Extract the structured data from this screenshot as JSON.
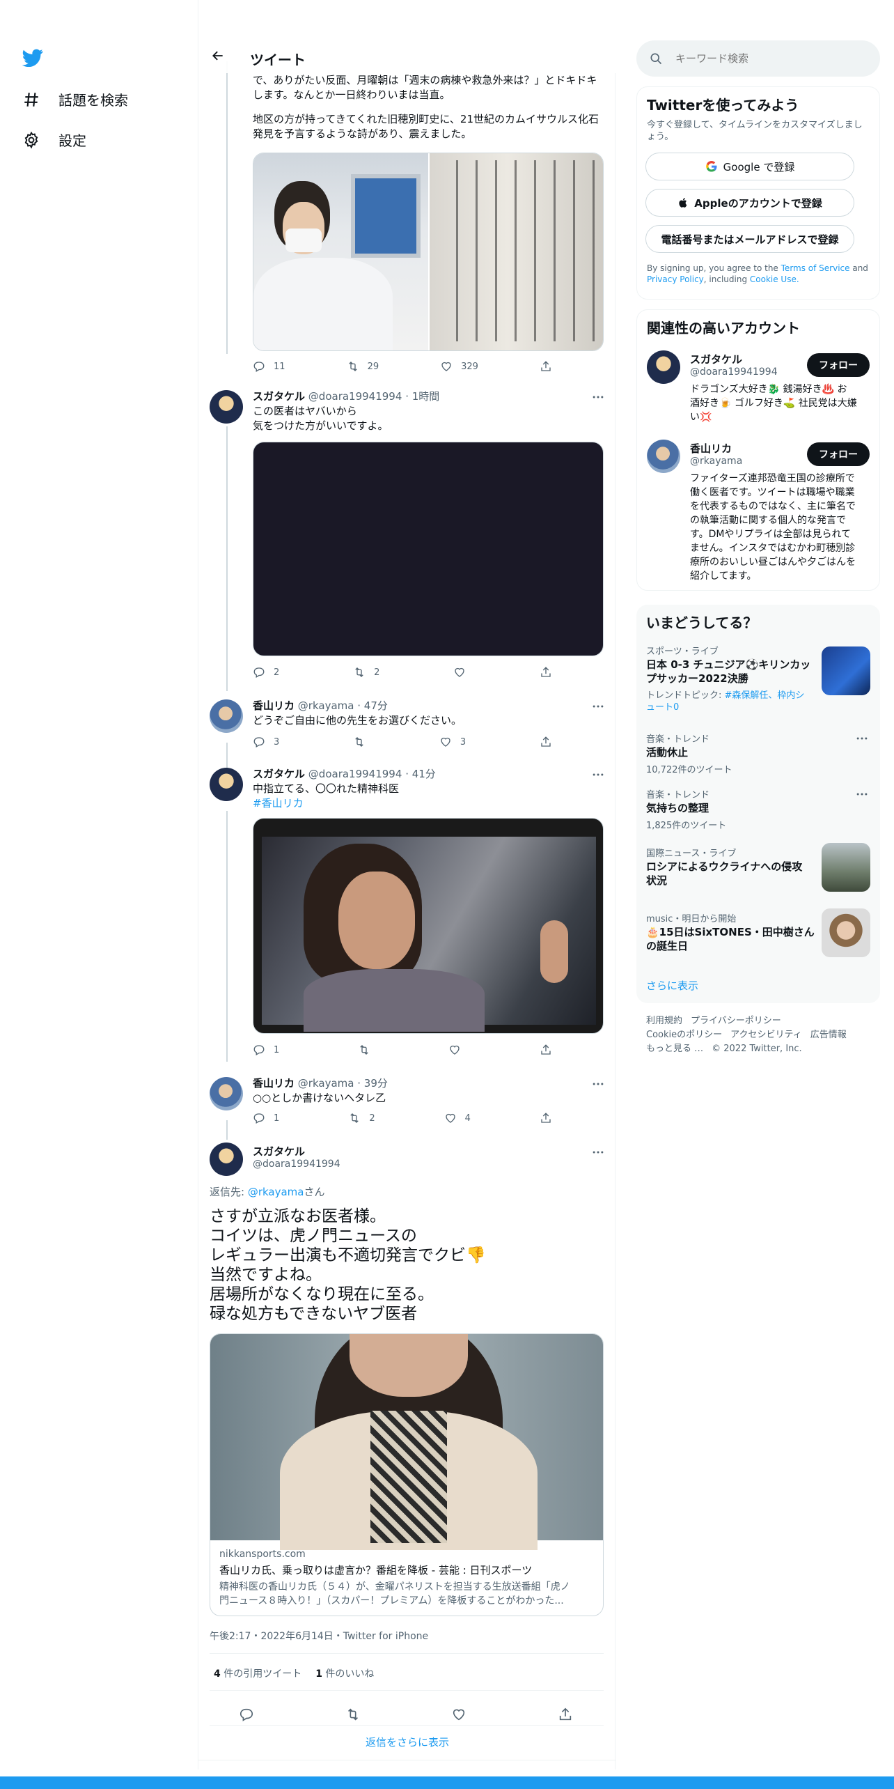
{
  "nav": {
    "explore_label": "話題を検索",
    "settings_label": "設定"
  },
  "header": {
    "title": "ツイート"
  },
  "tweet0": {
    "text1a": "で、ありがたい反面、月曜朝は「週末の病棟や救急外来は？」とドキドキ",
    "text1b": "します。なんとか一日終わりいまは当直。",
    "text2a": "地区の方が持ってきてくれた旧穂別町史に、21世紀のカムイサウルス化石",
    "text2b": "発見を予言するような詩があり、震えました。",
    "replies": "11",
    "retweets": "29",
    "likes": "329"
  },
  "tweet1": {
    "name": "スガタケル",
    "handle": "@doara19941994",
    "time": "· 1時間",
    "line1": "この医者はヤバいから",
    "line2": "気をつけた方がいいですよ。",
    "replies": "2",
    "retweets": "2"
  },
  "tweet2": {
    "name": "香山リカ",
    "handle": "@rkayama",
    "time": "· 47分",
    "text": "どうぞご自由に他の先生をお選びください。",
    "replies": "3",
    "likes": "3"
  },
  "tweet3": {
    "name": "スガタケル",
    "handle": "@doara19941994",
    "time": "· 41分",
    "line1": "中指立てる、〇〇れた精神科医",
    "hashtag": "#香山リカ",
    "replies": "1"
  },
  "tweet4": {
    "name": "香山リカ",
    "handle": "@rkayama",
    "time": "· 39分",
    "text": "○○としか書けないヘタレ乙",
    "replies": "1",
    "retweets": "2",
    "likes": "4"
  },
  "main_tweet": {
    "name": "スガタケル",
    "handle": "@doara19941994",
    "reply_to_prefix": "返信先: ",
    "reply_to_handle": "@rkayama",
    "reply_to_suffix": "さん",
    "lines": [
      "さすが立派なお医者様。",
      "コイツは、虎ノ門ニュースの",
      "レギュラー出演も不適切発言でクビ👎",
      "当然ですよね。",
      "居場所がなくなり現在に至る。",
      "碌な処方もできないヤブ医者"
    ],
    "card_domain": "nikkansports.com",
    "card_title": "香山リカ氏、乗っ取りは虚言か？番組を降板 - 芸能 : 日刊スポーツ",
    "card_desc1": "精神科医の香山リカ氏（５４）が、金曜パネリストを担当する生放送番組「虎ノ",
    "card_desc2": "門ニュース８時入り！」（スカパー！プレミアム）を降板することがわかった...",
    "timestamp": "午後2:17・2022年6月14日・Twitter for iPhone",
    "quote_count": "4",
    "quote_label": " 件の引用ツイート",
    "like_count": "1",
    "like_label": " 件のいいね",
    "show_more_replies": "返信をさらに表示"
  },
  "search": {
    "placeholder": "キーワード検索"
  },
  "signup": {
    "title": "Twitterを使ってみよう",
    "desc1": "今すぐ登録して、タイムラインをカスタマイズしまし",
    "desc2": "ょう。",
    "google": "Google で登録",
    "apple": "Appleのアカウントで登録",
    "phone": "電話番号またはメールアドレスで登録",
    "terms_prefix": "By signing up, you agree to the ",
    "terms_link": "Terms of Service",
    "terms_and": " and",
    "privacy_link": "Privacy Policy",
    "including": ", including ",
    "cookie_link": "Cookie Use."
  },
  "relevant": {
    "title": "関連性の高いアカウント",
    "follow_label": "フォロー",
    "accounts": [
      {
        "name": "スガタケル",
        "handle": "@doara19941994",
        "bio": [
          "ドラゴンズ大好き🐉 銭湯好き♨️ お",
          "酒好き🍺 ゴルフ好き⛳ 社民党は大嫌",
          "い💢"
        ]
      },
      {
        "name": "香山リカ",
        "handle": "@rkayama",
        "bio": [
          "ファイターズ連邦恐竜王国の診療所で",
          "働く医者です。ツイートは職場や職業",
          "を代表するものではなく、主に筆名で",
          "の執筆活動に関する個人的な発言で",
          "す。DMやリプライは全部は見られて",
          "ません。インスタではむかわ町穂別診",
          "療所のおいしい昼ごはんや夕ごはんを",
          "紹介してます。"
        ]
      }
    ]
  },
  "trends": {
    "title": "いまどうしてる？",
    "items": [
      {
        "category": "スポーツ・ライブ",
        "name1": "日本 0-3 チュニジア⚽キリンカッ",
        "name2": "プサッカー2022決勝",
        "extra_prefix": "トレンドトピック: ",
        "extra_link1": "#森保解任、枠内シ",
        "extra_link2": "ュート0"
      },
      {
        "category": "音楽・トレンド",
        "name1": "活動休止",
        "count": "10,722件のツイート"
      },
      {
        "category": "音楽・トレンド",
        "name1": "気持ちの整理",
        "count": "1,825件のツイート"
      },
      {
        "category": "国際ニュース・ライブ",
        "name1": "ロシアによるウクライナへの侵攻",
        "name2": "状況"
      },
      {
        "category": "music・明日から開始",
        "name1": "🎂15日はSixTONES・田中樹さん",
        "name2": "の誕生日"
      }
    ],
    "show_more": "さらに表示"
  },
  "footer": {
    "links_row1": [
      "利用規約",
      "プライバシーポリシー"
    ],
    "links_row2": [
      "Cookieのポリシー",
      "アクセシビリティ",
      "広告情報"
    ],
    "more": "もっと見る …",
    "copyright": "© 2022 Twitter, Inc."
  },
  "colors": {
    "accent": "#1d9bf0",
    "text": "#0f1419",
    "muted": "#536471"
  }
}
